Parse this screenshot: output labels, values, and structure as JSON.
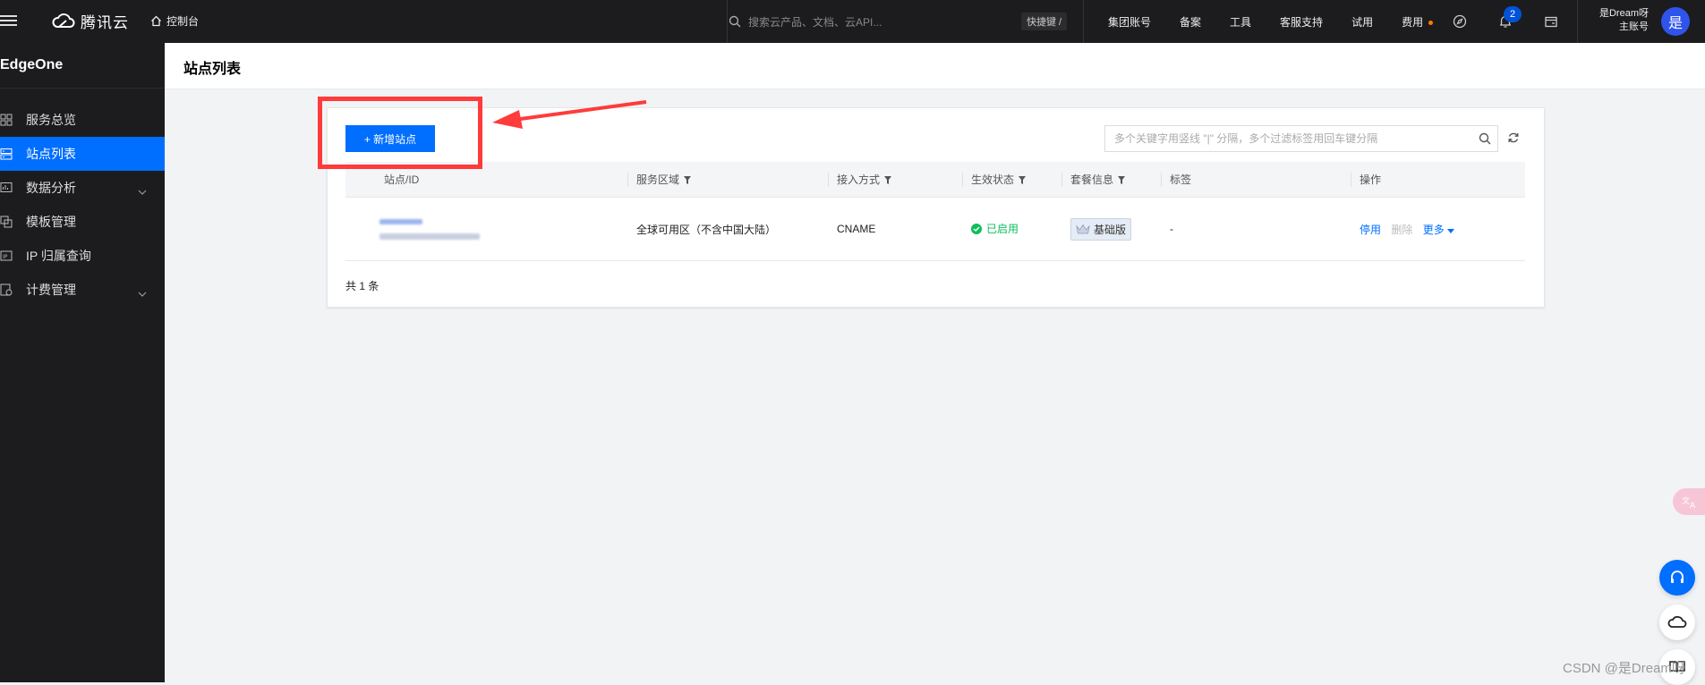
{
  "topbar": {
    "brand": "腾讯云",
    "console": "控制台",
    "search_placeholder": "搜索云产品、文档、云API...",
    "hotkey": "快捷键 /",
    "nav": [
      "集团账号",
      "备案",
      "工具",
      "客服支持",
      "试用",
      "费用"
    ],
    "notification_count": "2",
    "user_name": "是Dream呀",
    "user_role": "主账号",
    "avatar": "是"
  },
  "sidebar": {
    "title": "EdgeOne",
    "items": [
      {
        "label": "服务总览"
      },
      {
        "label": "站点列表"
      },
      {
        "label": "数据分析"
      },
      {
        "label": "模板管理"
      },
      {
        "label": "IP 归属查询"
      },
      {
        "label": "计费管理"
      }
    ]
  },
  "page": {
    "title": "站点列表",
    "add_button": "+ 新增站点",
    "filter_placeholder": "多个关键字用竖线 \"|\" 分隔，多个过滤标签用回车键分隔",
    "columns": [
      "站点/ID",
      "服务区域",
      "接入方式",
      "生效状态",
      "套餐信息",
      "标签",
      "操作"
    ],
    "rows": [
      {
        "region": "全球可用区（不含中国大陆）",
        "access": "CNAME",
        "status": "已启用",
        "plan": "基础版",
        "tag": "-",
        "ops": [
          "停用",
          "删除",
          "更多"
        ]
      }
    ],
    "total": "共 1 条"
  },
  "watermark": "CSDN @是Dream呀",
  "colors": {
    "accent": "#006eff",
    "success": "#0abf5b",
    "annotation": "#ff3b3b",
    "topbar": "#1c1c1e"
  }
}
